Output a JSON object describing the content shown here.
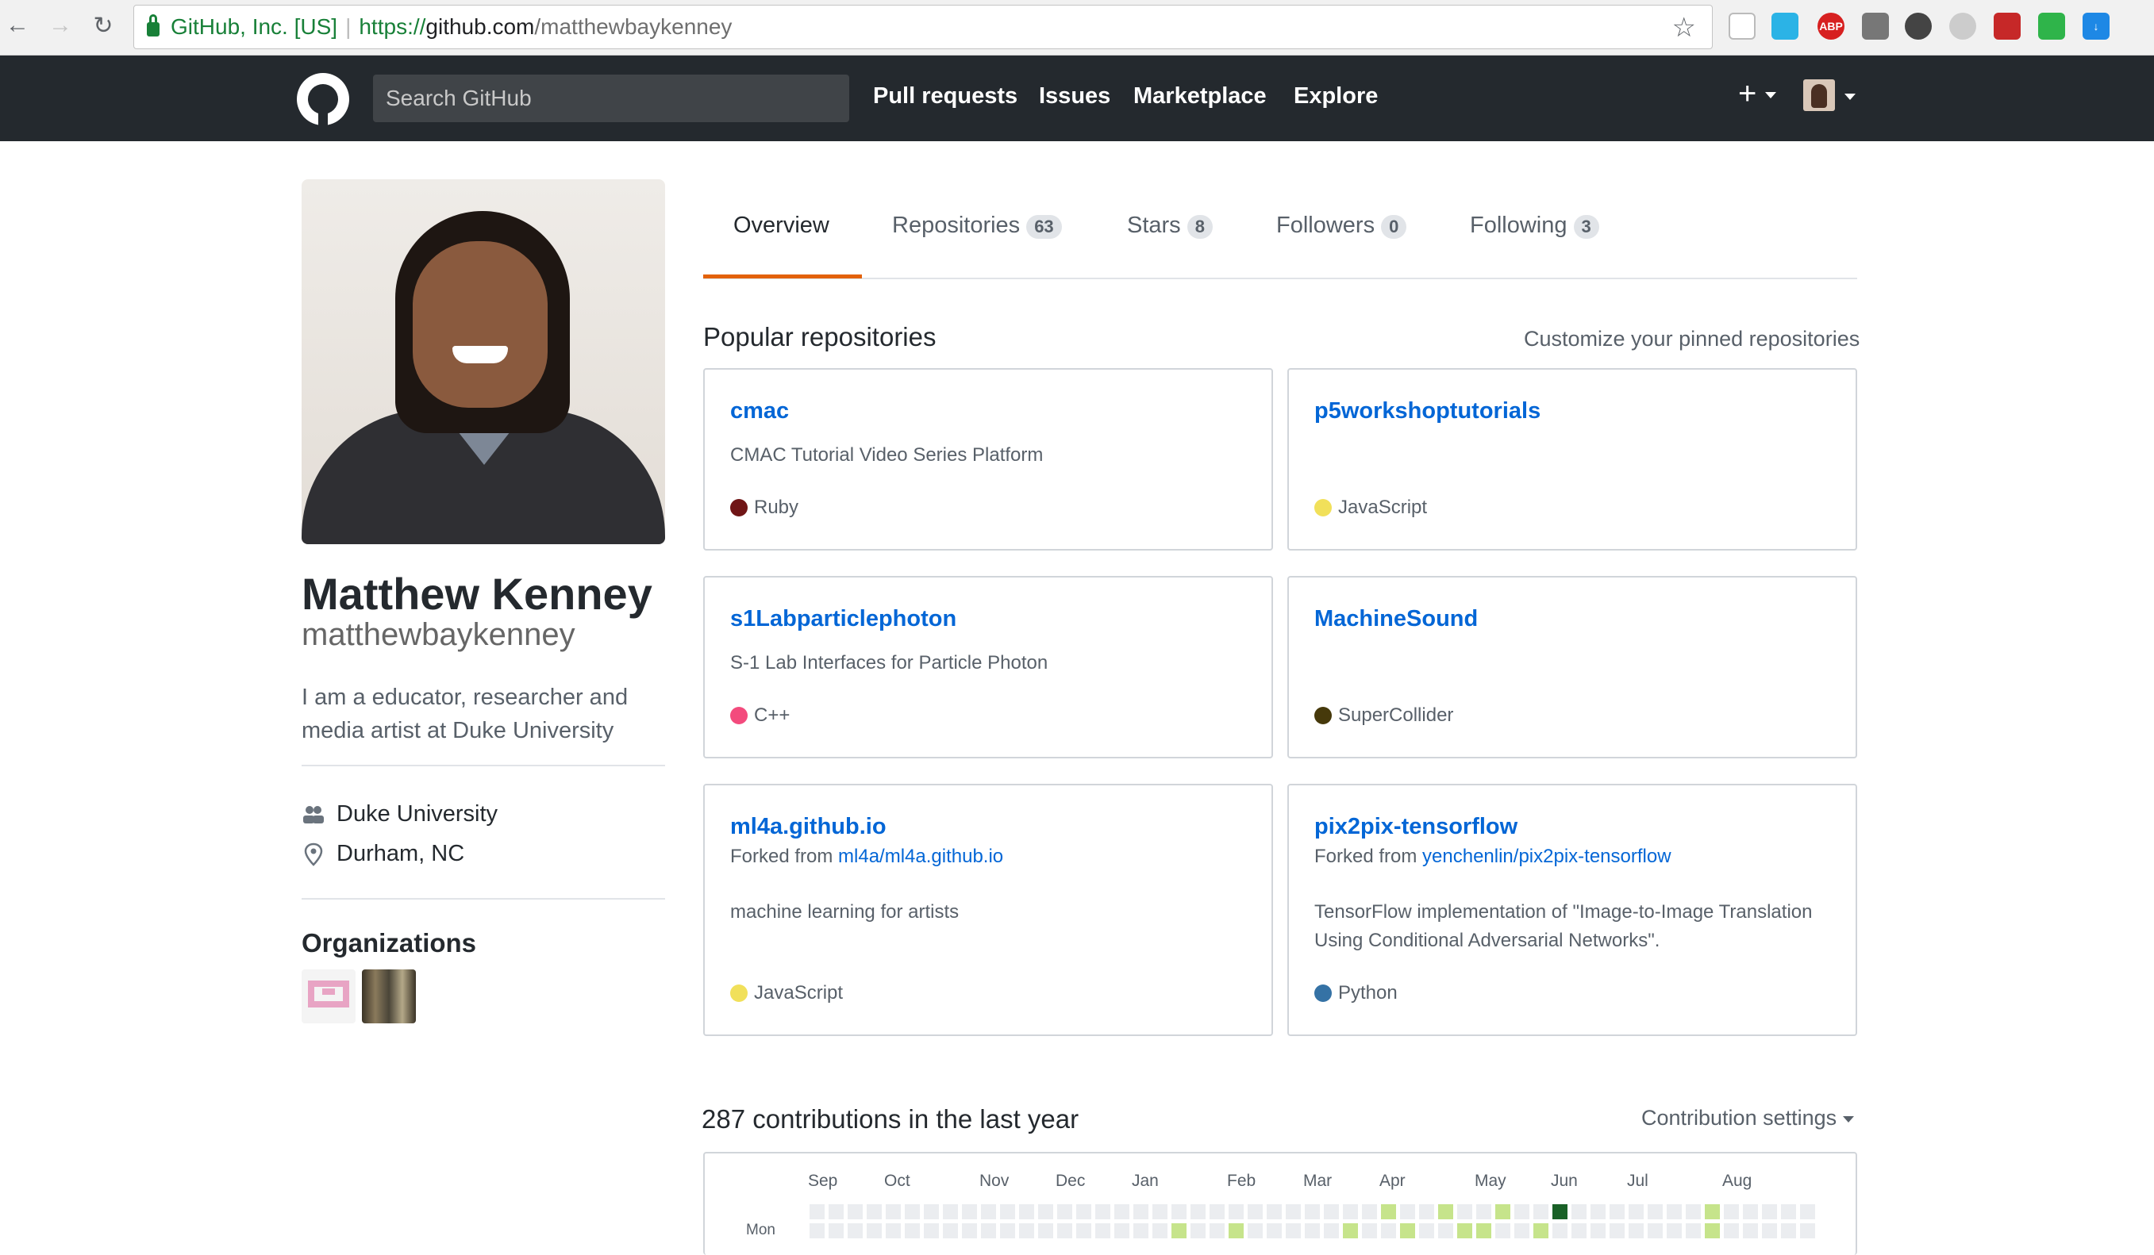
{
  "browser": {
    "ev_label": "GitHub, Inc. [US]",
    "url_scheme": "https://",
    "url_host": "github.com",
    "url_path": "/matthewbaykenney"
  },
  "header": {
    "search_placeholder": "Search GitHub",
    "nav": [
      "Pull requests",
      "Issues",
      "Marketplace",
      "Explore"
    ],
    "plus": "+"
  },
  "profile": {
    "fullname": "Matthew Kenney",
    "username": "matthewbaykenney",
    "bio": "I am a educator, researcher and media artist at Duke University",
    "company": "Duke University",
    "location": "Durham, NC",
    "orgs_title": "Organizations"
  },
  "tabs": [
    {
      "label": "Overview",
      "count": ""
    },
    {
      "label": "Repositories",
      "count": "63"
    },
    {
      "label": "Stars",
      "count": "8"
    },
    {
      "label": "Followers",
      "count": "0"
    },
    {
      "label": "Following",
      "count": "3"
    }
  ],
  "popular": {
    "title": "Popular repositories",
    "customize": "Customize your pinned repositories",
    "repos": [
      {
        "name": "cmac",
        "desc": "CMAC Tutorial Video Series Platform",
        "lang": "Ruby",
        "color": "#701516"
      },
      {
        "name": "p5workshoptutorials",
        "desc": "",
        "lang": "JavaScript",
        "color": "#f1e05a"
      },
      {
        "name": "s1Labparticlephoton",
        "desc": "S-1 Lab Interfaces for Particle Photon",
        "lang": "C++",
        "color": "#f34b7d"
      },
      {
        "name": "MachineSound",
        "desc": "",
        "lang": "SuperCollider",
        "color": "#46390b"
      },
      {
        "name": "ml4a.github.io",
        "fork_prefix": "Forked from ",
        "fork_src": "ml4a/ml4a.github.io",
        "desc": "machine learning for artists",
        "lang": "JavaScript",
        "color": "#f1e05a"
      },
      {
        "name": "pix2pix-tensorflow",
        "fork_prefix": "Forked from ",
        "fork_src": "yenchenlin/pix2pix-tensorflow",
        "desc": "TensorFlow implementation of \"Image-to-Image Translation Using Conditional Adversarial Networks\".",
        "lang": "Python",
        "color": "#3572A5"
      }
    ]
  },
  "contributions": {
    "title": "287 contributions in the last year",
    "settings": "Contribution settings",
    "months": [
      "Sep",
      "Oct",
      "Nov",
      "Dec",
      "Jan",
      "Feb",
      "Mar",
      "Apr",
      "May",
      "Jun",
      "Jul",
      "Aug"
    ],
    "day_label": "Mon"
  }
}
